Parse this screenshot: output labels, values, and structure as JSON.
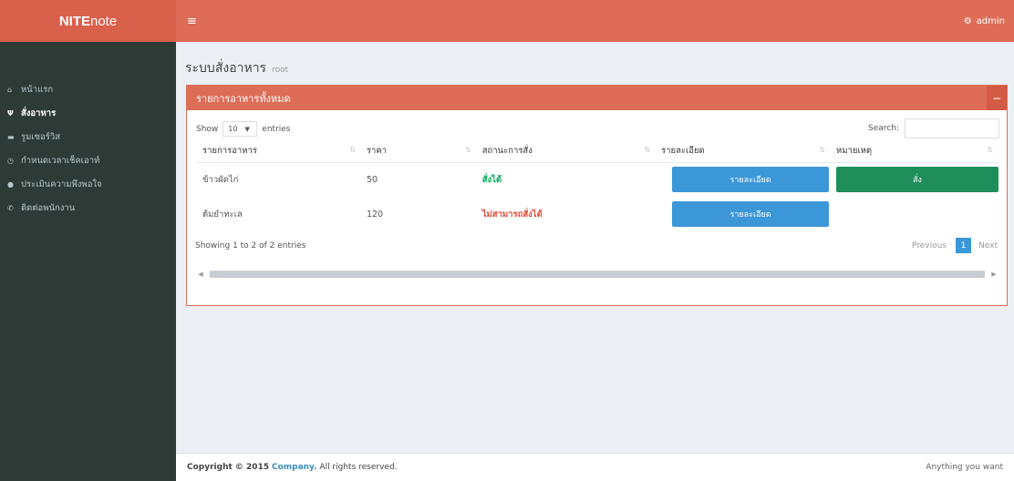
{
  "header": {
    "logo_bold": "NITE",
    "logo_rest": "note",
    "toggle_icon": "≡",
    "user_label": "admin"
  },
  "sidebar": {
    "items": [
      {
        "label": "หน้าแรก",
        "icon": "home-icon",
        "glyph": "⌂"
      },
      {
        "label": "สั่งอาหาร",
        "icon": "cutlery-icon",
        "glyph": "Ψ"
      },
      {
        "label": "รูมเซอร์วิส",
        "icon": "bed-icon",
        "glyph": "▬"
      },
      {
        "label": "กำหนดเวลาเช็คเอาท์",
        "icon": "clock-icon",
        "glyph": "◷"
      },
      {
        "label": "ประเมินความพึงพอใจ",
        "icon": "comment-icon",
        "glyph": "●"
      },
      {
        "label": "ติดต่อพนักงาน",
        "icon": "phone-icon",
        "glyph": "✆"
      }
    ],
    "active_index": 1
  },
  "page": {
    "title": "ระบบสั่งอาหาร",
    "subtitle": "root"
  },
  "box": {
    "title": "รายการอาหารทั้งหมด",
    "tool_label": "−"
  },
  "table_controls": {
    "show_label": "Show",
    "length_value": "10",
    "entries_label": "entries",
    "search_label": "Search:",
    "search_value": ""
  },
  "table": {
    "columns": [
      "รายการอาหาร",
      "ราคา",
      "สถานะการสั่ง",
      "รายละเอียด",
      "หมายเหตุ"
    ],
    "rows": [
      {
        "name": "ข้าวผัดไก่",
        "price": "50",
        "status": "สั่งได้",
        "status_ok": true,
        "detail_btn": "รายละเอียด",
        "order_btn": "สั่ง"
      },
      {
        "name": "ต้มยำทะเล",
        "price": "120",
        "status": "ไม่สามารถสั่งได้",
        "status_ok": false,
        "detail_btn": "รายละเอียด",
        "order_btn": ""
      }
    ]
  },
  "pagination": {
    "info": "Showing 1 to 2 of 2 entries",
    "previous": "Previous",
    "current": "1",
    "next": "Next"
  },
  "footer": {
    "copyright_prefix": "Copyright © 2015",
    "company": "Company.",
    "suffix": "All rights reserved.",
    "right_text": "Anything you want"
  },
  "colors": {
    "brand": "#dd6d57",
    "sidebar": "#2e3a36",
    "primary_button": "#3c97d8",
    "order_button": "#1f8e5b",
    "status_ok": "#00a65a",
    "status_no": "#dd4b39"
  }
}
